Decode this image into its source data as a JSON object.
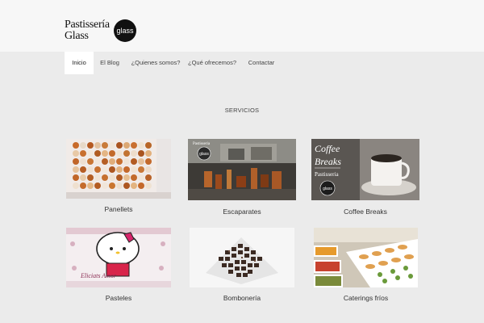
{
  "brand": {
    "line1": "Pastissería",
    "line2": "Glass",
    "logo_text": "glass"
  },
  "nav": {
    "items": [
      {
        "label": "Inicio",
        "active": true
      },
      {
        "label": "El Blog"
      },
      {
        "label": "¿Quienes somos?"
      },
      {
        "label": "¿Qué ofrecemos?"
      },
      {
        "label": "Contactar"
      }
    ]
  },
  "section": {
    "title": "SERVICIOS"
  },
  "services": [
    {
      "caption": "Panellets"
    },
    {
      "caption": "Escaparates",
      "image_text": "Pastisseria",
      "logo_text": "glass"
    },
    {
      "caption": "Coffee Breaks",
      "image_text_1": "Coffee",
      "image_text_2": "Breaks",
      "image_text_3": "Pastisseria",
      "logo_text": "glass"
    },
    {
      "caption": "Pasteles",
      "image_text": "Eliciats Amor"
    },
    {
      "caption": "Bombonería"
    },
    {
      "caption": "Caterings fríos"
    }
  ]
}
